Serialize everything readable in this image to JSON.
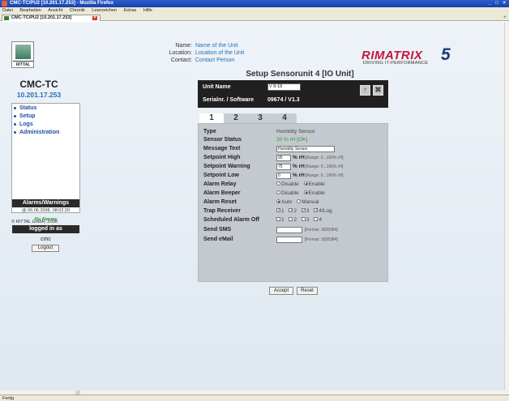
{
  "window": {
    "title": "CMC-TC/PU2 [10.201.17.253] - Mozilla Firefox",
    "controls": "_ □ ×"
  },
  "menu": [
    "Datei",
    "Bearbeiten",
    "Ansicht",
    "Chronik",
    "Lesezeichen",
    "Extras",
    "Hilfe"
  ],
  "browser_tab": {
    "label": "CMC-TC/PU2 [10.201.17.253]"
  },
  "statusbar": {
    "text": "Fertig"
  },
  "sidebar": {
    "logo_text": "RITTAL",
    "device_name": "CMC-TC",
    "device_ip": "10.201.17.253",
    "nav": [
      {
        "label": "Status"
      },
      {
        "label": "Setup"
      },
      {
        "label": "Logs"
      },
      {
        "label": "Administration"
      }
    ],
    "alarms_header": "Alarms/Warnings",
    "alarms_timestamp": "@ 06.06.2008, 08:02:20",
    "alarms_status": "No Alarms",
    "logged_header": "logged in as",
    "user": "cmc",
    "logout_label": "Logout",
    "copyright": "© RITTAL GmbH, 2008"
  },
  "header": {
    "labels": [
      "Name:",
      "Location:",
      "Contact:"
    ],
    "values": [
      "Name of the Unit",
      "Location of the Unit",
      "Contact Person"
    ],
    "brand_word": "RIMATRIX",
    "brand_number": "5",
    "brand_tagline": "DRIVING IT-PERFORMANCE",
    "page_title": "Setup Sensorunit 4 [IO Unit]"
  },
  "unit": {
    "name_label": "Unit Name",
    "name_value": "V 8-18",
    "serial_label": "Serialnr. / Software",
    "serial_value": "09674 / V1.3",
    "up_icon": "arrow-up-icon",
    "close_icon": "close-icon"
  },
  "tabs": [
    {
      "label": "1",
      "active": true
    },
    {
      "label": "2",
      "active": false
    },
    {
      "label": "3",
      "active": false
    },
    {
      "label": "4",
      "active": false
    }
  ],
  "form": {
    "type_label": "Type",
    "type_value": "Humidity Sensor",
    "status_label": "Sensor Status",
    "status_value": "30 % rH [OK]",
    "message_label": "Message Text",
    "message_value": "Humidity Sensor",
    "high_label": "Setpoint High",
    "high_value": "95",
    "warning_label": "Setpoint Warning",
    "warning_value": "75",
    "low_label": "Setpoint Low",
    "low_value": "0",
    "unit": "% rH",
    "range": "[Range: 0...100% rH]",
    "relay_label": "Alarm Relay",
    "beeper_label": "Alarm Beeper",
    "disable": "Disable",
    "enable": "Enable",
    "reset_label": "Alarm Reset",
    "auto": "Auto",
    "manual": "Manual",
    "trap_label": "Trap Receiver",
    "trap_opts": [
      "1",
      "2",
      "3",
      "4/Log"
    ],
    "sched_label": "Scheduled Alarm Off",
    "sched_opts": [
      "1",
      "2",
      "3",
      "4"
    ],
    "sms_label": "Send SMS",
    "sms_format": "[Format: 1828384]",
    "email_label": "Send eMail",
    "email_format": "[Format: 1828384]"
  },
  "buttons": {
    "accept": "Accept",
    "reset": "Reset"
  }
}
